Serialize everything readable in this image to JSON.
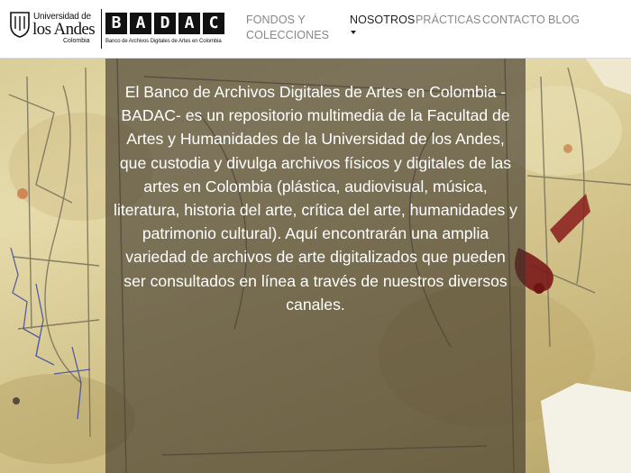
{
  "header": {
    "university_logo": {
      "line1": "Universidad de",
      "line2": "los Andes",
      "line3": "Colombia",
      "icon": "university-crest-icon"
    },
    "badac_logo": {
      "letters": [
        "B",
        "A",
        "D",
        "A",
        "C"
      ],
      "subtitle": "Banco de Archivos Digitales de Artes en Colombia"
    },
    "nav": {
      "fondos": "FONDOS Y COLECCIONES",
      "nosotros": "NOSOTROS",
      "practicas": "PRÁCTICAS",
      "contacto": "CONTACTO",
      "blog": "BLOG"
    }
  },
  "hero": {
    "text": "El Banco de Archivos Digitales de Artes en Colombia -BADAC- es un repositorio multimedia de la Facultad de Artes y Humanidades de la Universidad de los Andes, que custodia y divulga archivos físicos y digitales de las artes en Colombia (plástica, audiovisual, música, literatura, historia del arte, crítica del arte, humanidades y patrimonio cultural). Aquí encontrarán una amplia variedad de archivos de arte digitalizados que pueden ser consultados en línea a través de nuestros diversos canales."
  },
  "colors": {
    "nav_inactive": "#888888",
    "nav_active": "#222222",
    "overlay": "rgba(60,52,40,0.62)",
    "paper": "#ddd09c"
  }
}
